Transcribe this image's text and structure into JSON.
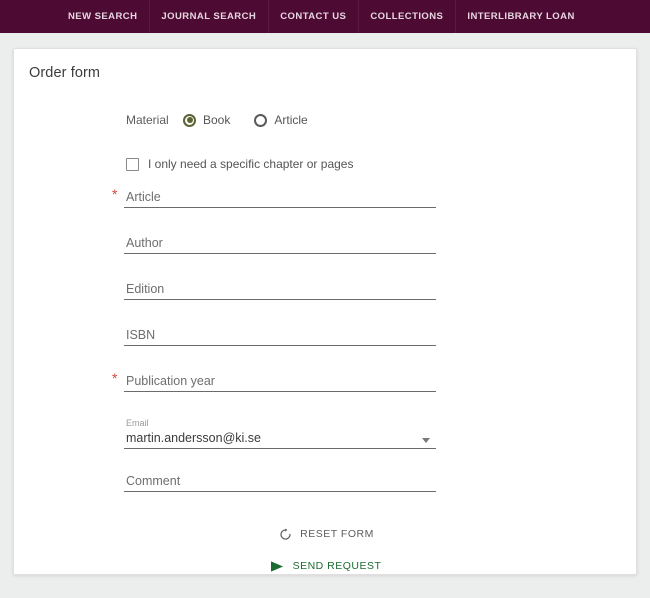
{
  "nav": {
    "items": [
      {
        "label": "NEW SEARCH"
      },
      {
        "label": "JOURNAL SEARCH"
      },
      {
        "label": "CONTACT US"
      },
      {
        "label": "COLLECTIONS"
      },
      {
        "label": "INTERLIBRARY LOAN"
      }
    ],
    "background_color": "#4d0a33",
    "text_color": "#e6d7e0"
  },
  "card": {
    "title": "Order form"
  },
  "form": {
    "material": {
      "label": "Material",
      "options": [
        {
          "label": "Book",
          "selected": true
        },
        {
          "label": "Article",
          "selected": false
        }
      ],
      "selected_color": "#5a6433"
    },
    "chapter_checkbox": {
      "label": "I only need a specific chapter or pages",
      "checked": false
    },
    "fields": [
      {
        "name": "article",
        "placeholder": "Article",
        "value": "",
        "required": true
      },
      {
        "name": "author",
        "placeholder": "Author",
        "value": "",
        "required": false
      },
      {
        "name": "edition",
        "placeholder": "Edition",
        "value": "",
        "required": false
      },
      {
        "name": "isbn",
        "placeholder": "ISBN",
        "value": "",
        "required": false
      },
      {
        "name": "publication_year",
        "placeholder": "Publication year",
        "value": "",
        "required": true
      }
    ],
    "email": {
      "label": "Email",
      "value": "martin.andersson@ki.se",
      "required": false
    },
    "comment": {
      "placeholder": "Comment",
      "value": ""
    },
    "required_marker": "*",
    "required_marker_color": "#d9443f"
  },
  "actions": {
    "reset": {
      "label": "RESET FORM",
      "icon": "refresh-icon",
      "color": "#5c5c5c"
    },
    "send": {
      "label": "SEND REQUEST",
      "icon": "send-icon",
      "color": "#1c6b32"
    }
  }
}
